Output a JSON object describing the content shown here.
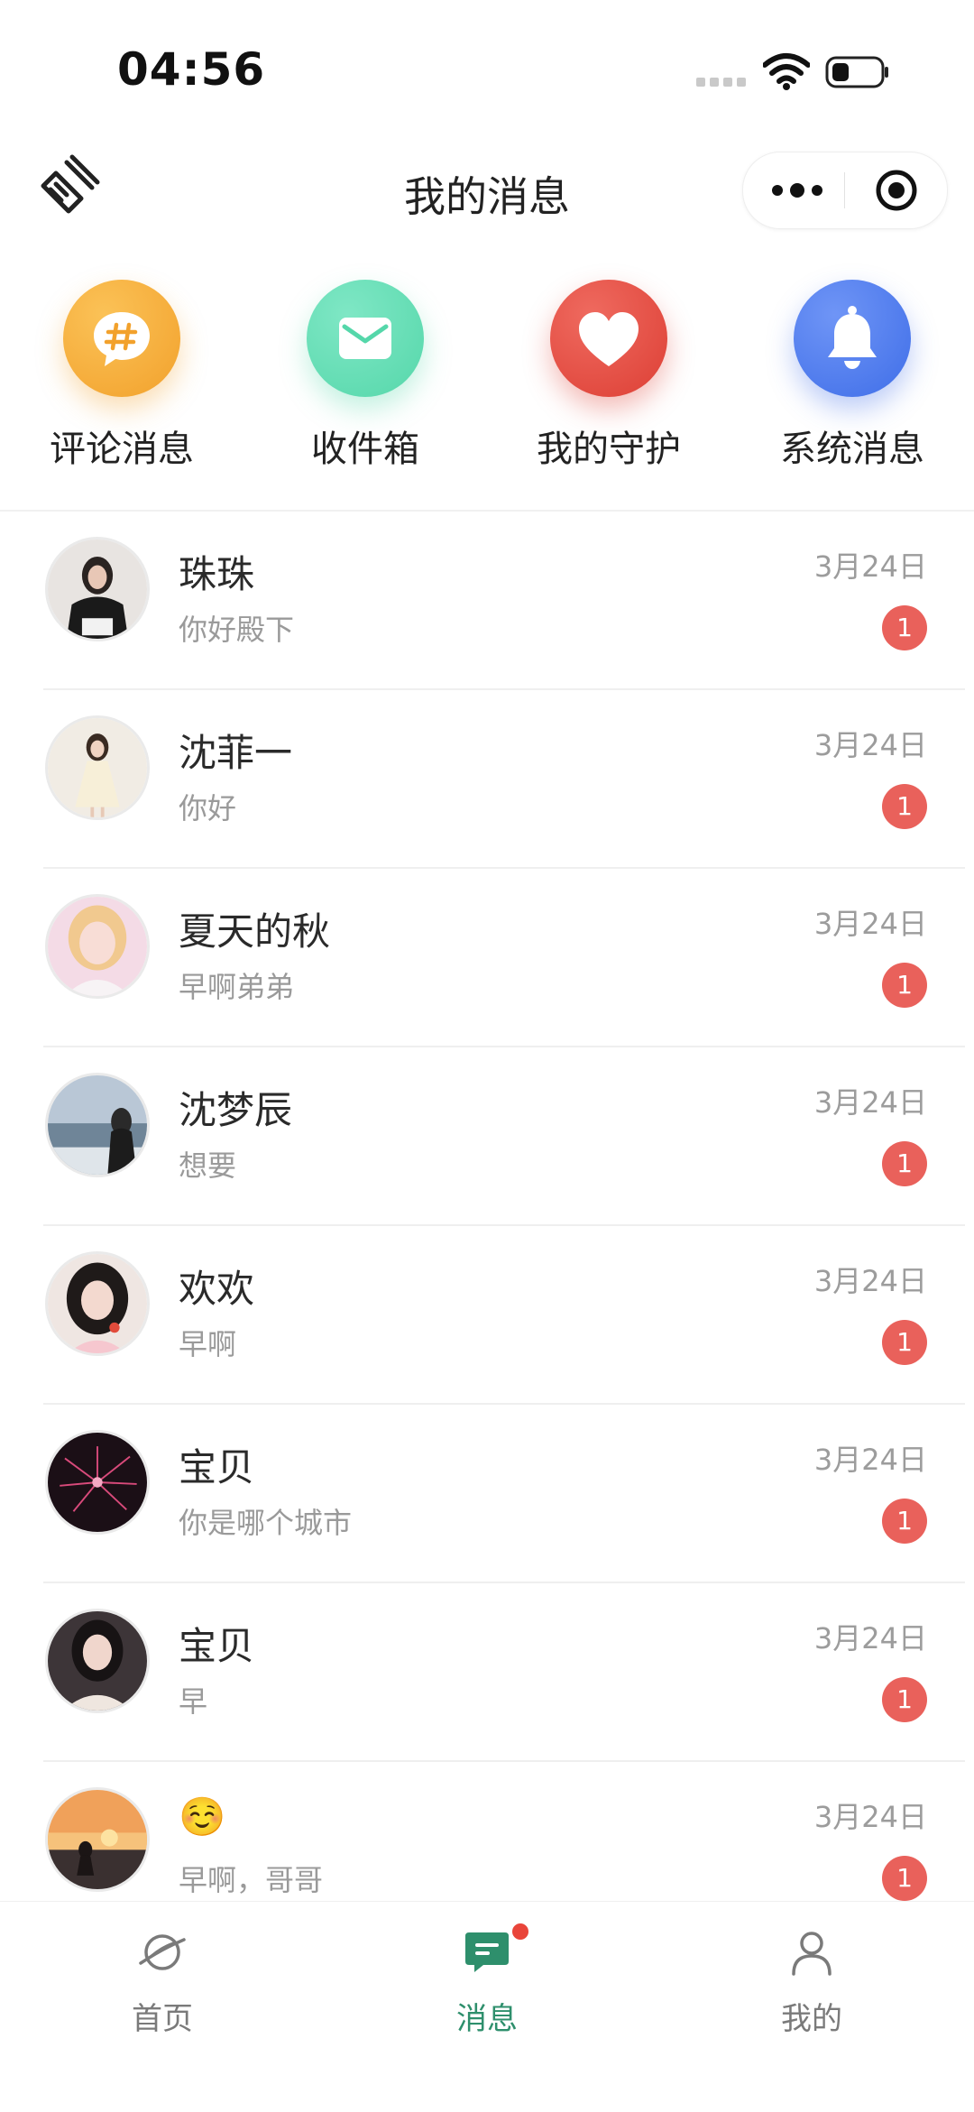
{
  "status_bar": {
    "time": "04:56"
  },
  "nav": {
    "title": "我的消息"
  },
  "quick_actions": [
    {
      "label": "评论消息",
      "icon": "comment-hash-icon",
      "color": "#f2a12c"
    },
    {
      "label": "收件箱",
      "icon": "mail-icon",
      "color": "#55d7aa"
    },
    {
      "label": "我的守护",
      "icon": "heart-icon",
      "color": "#dd3f35"
    },
    {
      "label": "系统消息",
      "icon": "bell-icon",
      "color": "#3f6ee8"
    }
  ],
  "messages": [
    {
      "name": "珠珠",
      "preview": "你好殿下",
      "time": "3月24日",
      "unread": "1"
    },
    {
      "name": "沈菲一",
      "preview": "你好",
      "time": "3月24日",
      "unread": "1"
    },
    {
      "name": "夏天的秋",
      "preview": "早啊弟弟",
      "time": "3月24日",
      "unread": "1"
    },
    {
      "name": "沈梦辰",
      "preview": "想要",
      "time": "3月24日",
      "unread": "1"
    },
    {
      "name": "欢欢",
      "preview": "早啊",
      "time": "3月24日",
      "unread": "1"
    },
    {
      "name": "宝贝",
      "preview": "你是哪个城市",
      "time": "3月24日",
      "unread": "1"
    },
    {
      "name": "宝贝",
      "preview": "早",
      "time": "3月24日",
      "unread": "1"
    },
    {
      "name": "☺️",
      "preview": "早啊，哥哥",
      "time": "3月24日",
      "unread": "1"
    }
  ],
  "tab_bar": {
    "tabs": [
      {
        "label": "首页",
        "icon": "planet-icon"
      },
      {
        "label": "消息",
        "icon": "chat-icon",
        "active": true
      },
      {
        "label": "我的",
        "icon": "person-icon"
      }
    ]
  },
  "colors": {
    "accent": "#2e8f6c",
    "badge": "#e9615b"
  }
}
